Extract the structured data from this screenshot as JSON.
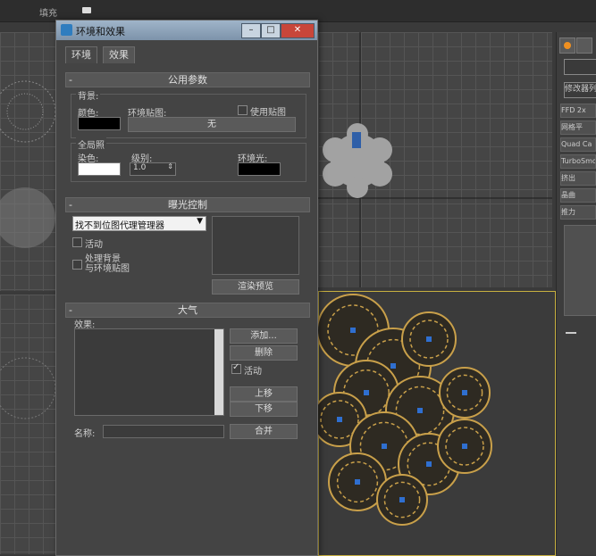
{
  "topbar": {
    "left_text": "填充",
    "mid_icon": "monitor-icon"
  },
  "dialog": {
    "title": "环境和效果",
    "tabs": [
      {
        "label": "环境"
      },
      {
        "label": "效果"
      }
    ],
    "common": {
      "rollout_title": "公用参数",
      "background_group": "背景:",
      "color_label": "颜色:",
      "env_map_label": "环境贴图:",
      "use_map_label": "使用贴图",
      "none_button": "无",
      "global_group": "全局照",
      "tint_label": "染色:",
      "level_label": "级别:",
      "level_value": "1.0",
      "ambient_label": "环境光:"
    },
    "exposure": {
      "rollout_title": "曝光控制",
      "select_value": "找不到位图代理管理器",
      "active_label": "活动",
      "process_label_1": "处理背景",
      "process_label_2": "与环境贴图",
      "render_preview": "渲染预览"
    },
    "atmosphere": {
      "rollout_title": "大气",
      "effects_label": "效果:",
      "add_button": "添加...",
      "delete_button": "删除",
      "active_label": "活动",
      "move_up": "上移",
      "move_down": "下移",
      "name_label": "名称:",
      "merge_button": "合并"
    }
  },
  "right_panel": {
    "modifier_list": "修改器列",
    "items": [
      "FFD 2x",
      "网格平",
      "Quad Ca",
      "TurboSmo",
      "挤出",
      "晶曲",
      "推力"
    ]
  },
  "colors": {
    "accent_red": "#e03a3a",
    "viewport_highlight": "#c8b040",
    "sphere_gold": "#c9a04a",
    "sphere_blue": "#2f6fd0"
  }
}
